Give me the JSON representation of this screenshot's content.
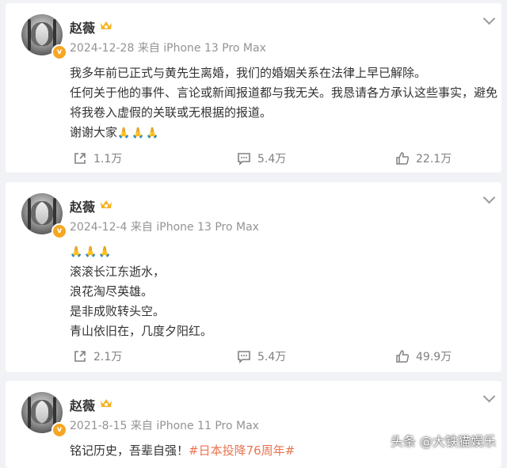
{
  "posts": [
    {
      "author": "赵薇",
      "date": "2024-12-28",
      "source": "来自 iPhone 13 Pro Max",
      "lines": [
        "我多年前已正式与黄先生离婚，我们的婚姻关系在法律上早已解除。",
        "任何关于他的事件、言论或新闻报道都与我无关。我恳请各方承认这些事实，避免",
        "将我卷入虚假的关联或无根据的报道。",
        "谢谢大家"
      ],
      "hands": "🙏🙏🙏",
      "reposts": "1.1万",
      "comments": "5.4万",
      "likes": "22.1万"
    },
    {
      "author": "赵薇",
      "date": "2024-12-4",
      "source": "来自 iPhone 13 Pro Max",
      "hands": "🙏🙏🙏",
      "lines": [
        "滚滚长江东逝水，",
        "浪花淘尽英雄。",
        "是非成败转头空。",
        "青山依旧在，几度夕阳红。"
      ],
      "reposts": "2.1万",
      "comments": "5.4万",
      "likes": "49.9万"
    },
    {
      "author": "赵薇",
      "date": "2021-8-15",
      "source": "来自 iPhone 11 Pro Max",
      "text": "铭记历史，吾辈自强！",
      "hashtag": "#日本投降76周年#"
    }
  ],
  "watermark": "头条 @大铁猫娱乐",
  "icons": {
    "repost": "share-icon",
    "comment": "comment-icon",
    "like": "thumbs-up-icon",
    "more": "chevron-down-icon",
    "verified": "verified-badge-icon"
  },
  "colors": {
    "hashtag": "#eb7350",
    "meta": "#939393",
    "verified": "#f5a623",
    "background": "#f1f2f5"
  }
}
